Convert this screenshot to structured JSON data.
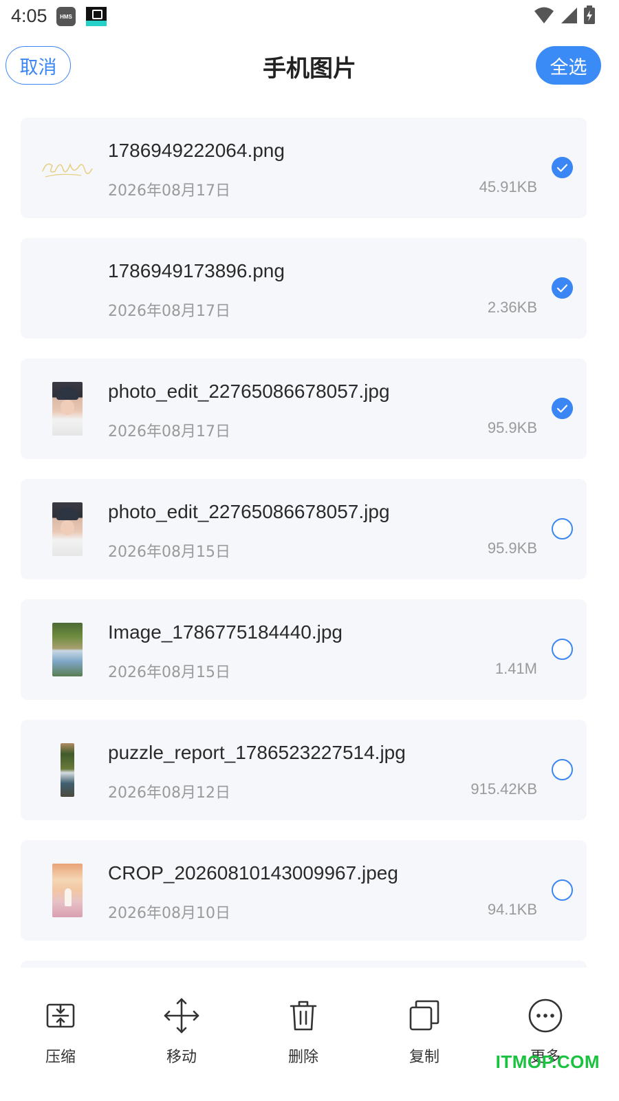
{
  "status_bar": {
    "time": "4:05",
    "hms_badge": "HMS",
    "icons": [
      "wifi-icon",
      "cell-signal-icon",
      "battery-charging-icon"
    ]
  },
  "header": {
    "cancel_label": "取消",
    "title": "手机图片",
    "select_all_label": "全选"
  },
  "files": [
    {
      "name": "1786949222064.png",
      "date": "2026年08月17日",
      "size": "45.91KB",
      "selected": true,
      "thumb": "signature"
    },
    {
      "name": "1786949173896.png",
      "date": "2026年08月17日",
      "size": "2.36KB",
      "selected": true,
      "thumb": "blank"
    },
    {
      "name": "photo_edit_22765086678057.jpg",
      "date": "2026年08月17日",
      "size": "95.9KB",
      "selected": true,
      "thumb": "portrait"
    },
    {
      "name": "photo_edit_22765086678057.jpg",
      "date": "2026年08月15日",
      "size": "95.9KB",
      "selected": false,
      "thumb": "portrait"
    },
    {
      "name": "Image_1786775184440.jpg",
      "date": "2026年08月15日",
      "size": "1.41M",
      "selected": false,
      "thumb": "landscape"
    },
    {
      "name": "puzzle_report_1786523227514.jpg",
      "date": "2026年08月12日",
      "size": "915.42KB",
      "selected": false,
      "thumb": "puzzle"
    },
    {
      "name": "CROP_20260810143009967.jpeg",
      "date": "2026年08月10日",
      "size": "94.1KB",
      "selected": false,
      "thumb": "crop"
    }
  ],
  "toolbar": {
    "compress_label": "压缩",
    "move_label": "移动",
    "delete_label": "删除",
    "copy_label": "复制",
    "more_label": "更多"
  },
  "watermark": "ITMOP.COM",
  "colors": {
    "accent": "#3b86f5",
    "card_bg": "#f6f7fb",
    "secondary_text": "#9a9a9a",
    "watermark": "#19c23f"
  }
}
